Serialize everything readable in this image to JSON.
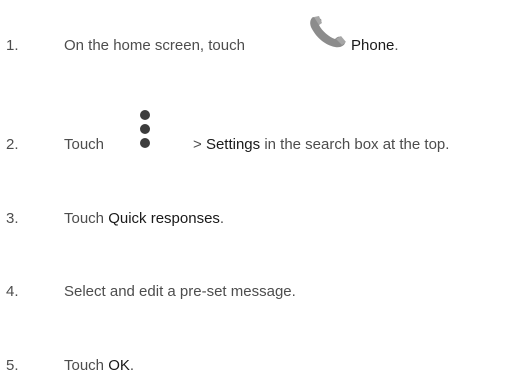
{
  "steps": [
    {
      "number": "1.",
      "before": "On the home screen, touch",
      "icon": "phone-handset-icon",
      "bold": "Phone",
      "after": "."
    },
    {
      "number": "2.",
      "before": "Touch",
      "icon": "overflow-menu-icon",
      "after_icon": ">",
      "bold": "Settings",
      "after": "in the search box at the top."
    },
    {
      "number": "3.",
      "before": "Touch",
      "bold": "Quick responses",
      "after": "."
    },
    {
      "number": "4.",
      "before": "Select and edit a pre-set message."
    },
    {
      "number": "5.",
      "before": "Touch",
      "bold": "OK",
      "after": "."
    }
  ],
  "colors": {
    "text": "#4d4d4d",
    "emphasis": "#1a1a1a",
    "icon": "#8c8c8c"
  }
}
